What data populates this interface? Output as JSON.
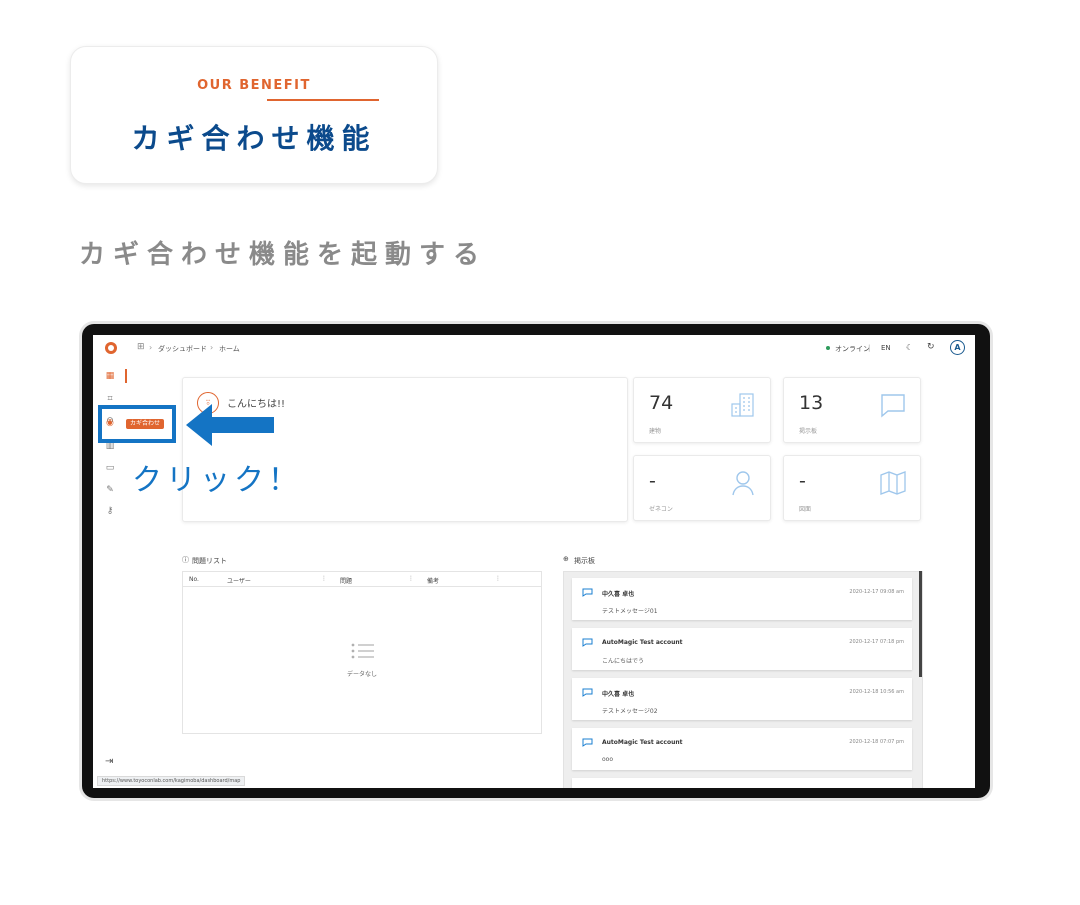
{
  "header": {
    "eyebrow": "OUR BENEFIT",
    "title": "カギ合わせ機能",
    "step_title": "カギ合わせ機能を起動する"
  },
  "app": {
    "breadcrumb": [
      "ダッシュボード",
      "ホーム"
    ],
    "topbar": {
      "status": "オンライン",
      "lang": "EN",
      "avatar": "A"
    },
    "sidebar_tooltip": "カギ合わせ",
    "greeting": "こんにちは!!",
    "stats": [
      {
        "value": "74",
        "label": "建物",
        "icon": "building-icon"
      },
      {
        "value": "13",
        "label": "掲示板",
        "icon": "chat-icon"
      },
      {
        "value": "-",
        "label": "ゼネコン",
        "icon": "person-icon"
      },
      {
        "value": "-",
        "label": "図面",
        "icon": "map-icon"
      }
    ],
    "issues": {
      "title": "問題リスト",
      "columns": [
        "No.",
        "ユーザー",
        "問題",
        "備考"
      ],
      "empty": "データなし"
    },
    "board": {
      "title": "掲示板",
      "messages": [
        {
          "user": "中久喜 卓也",
          "time": "2020-12-17 09:08 am",
          "body": "テストメッセージ01"
        },
        {
          "user": "AutoMagic Test account",
          "time": "2020-12-17 07:18 pm",
          "body": "こんにちはでう"
        },
        {
          "user": "中久喜 卓也",
          "time": "2020-12-18 10:56 am",
          "body": "テストメッセージ02"
        },
        {
          "user": "AutoMagic Test account",
          "time": "2020-12-18 07:07 pm",
          "body": "ooo"
        }
      ]
    },
    "status_url": "https://www.toyoconlab.com/kagimoba/dashboard/map"
  },
  "callout": {
    "text": "クリック！"
  },
  "colors": {
    "accent_orange": "#e0652f",
    "accent_blue": "#1474c4",
    "title_blue": "#0b4a8c"
  }
}
